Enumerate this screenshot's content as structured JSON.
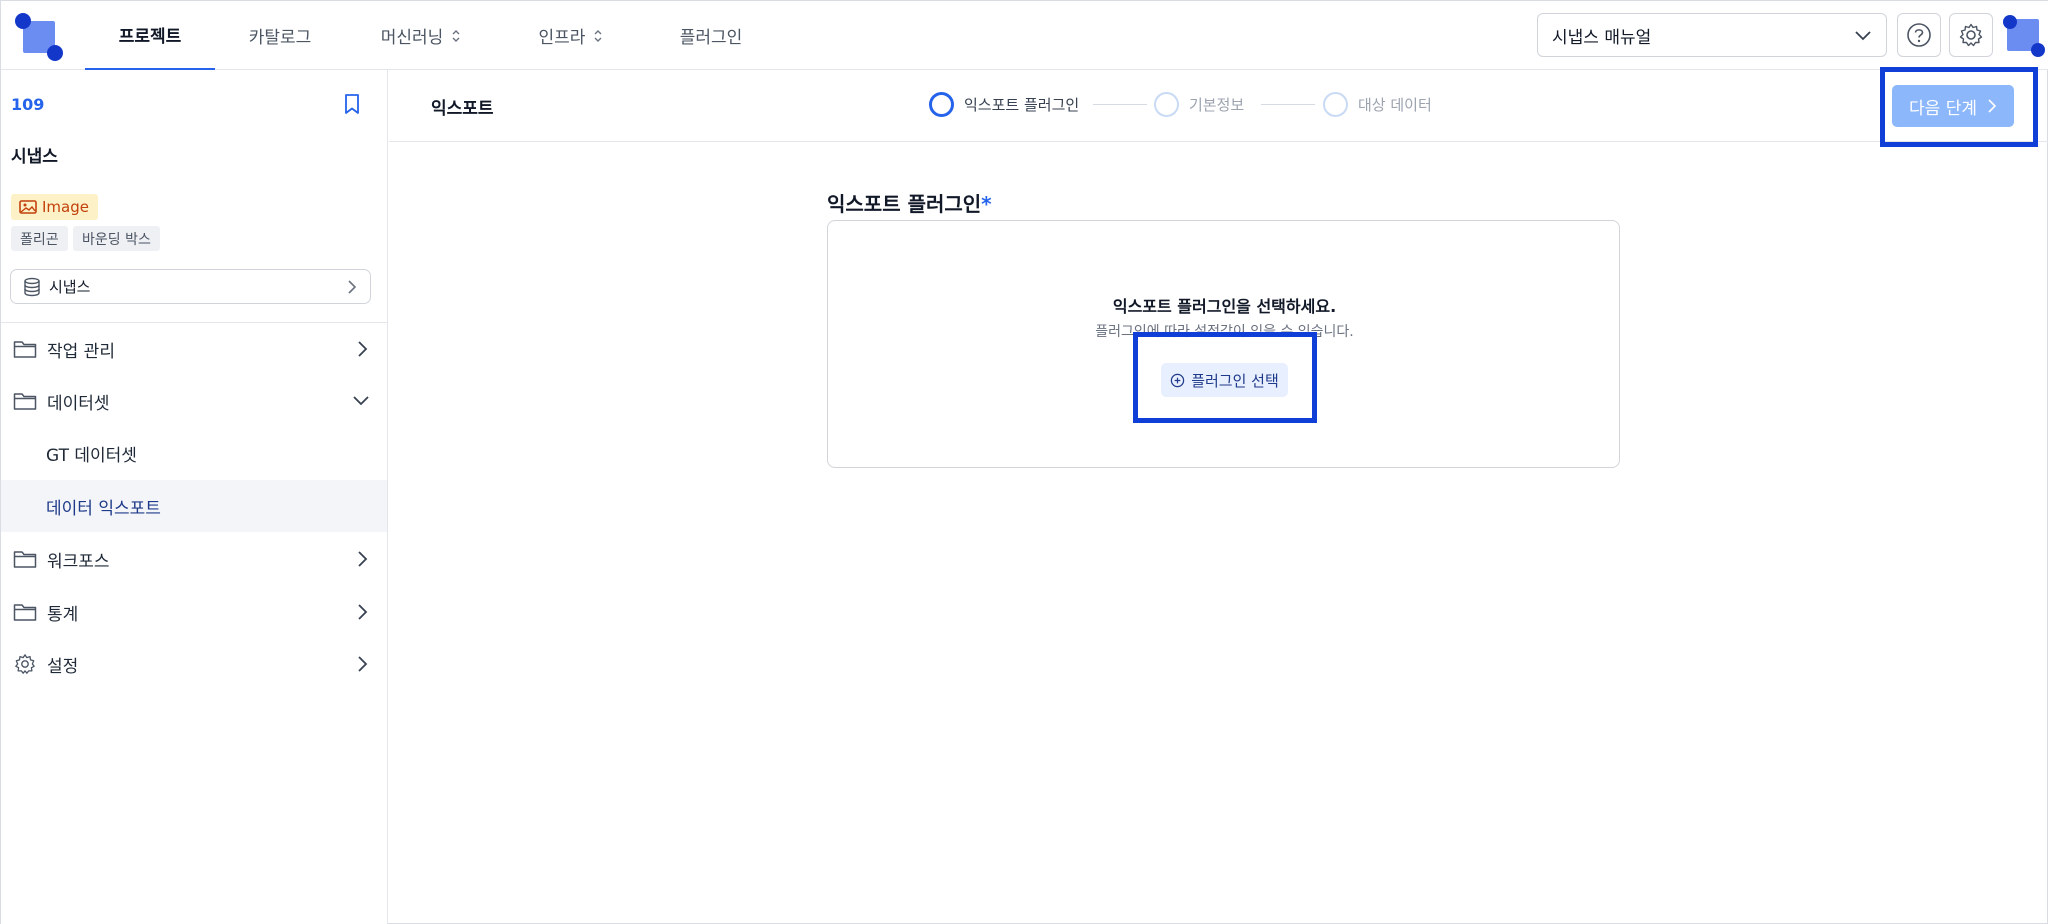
{
  "nav": {
    "items": [
      {
        "label": "프로젝트",
        "active": true
      },
      {
        "label": "카탈로그"
      },
      {
        "label": "머신러닝",
        "dropdown": true
      },
      {
        "label": "인프라",
        "dropdown": true
      },
      {
        "label": "플러그인"
      }
    ],
    "manual_select": "시냅스 매뉴얼"
  },
  "sidebar": {
    "project_id": "109",
    "project_name": "시냅스",
    "data_type_badge": "Image",
    "tags": [
      "폴리곤",
      "바운딩 박스"
    ],
    "dataset_selector": "시냅스",
    "menu": [
      {
        "label": "작업 관리"
      },
      {
        "label": "데이터셋",
        "expanded": true,
        "children": [
          {
            "label": "GT 데이터셋"
          },
          {
            "label": "데이터 익스포트",
            "active": true
          }
        ]
      },
      {
        "label": "워크포스"
      },
      {
        "label": "통계"
      },
      {
        "label": "설정"
      }
    ]
  },
  "main": {
    "page_title": "익스포트",
    "steps": [
      {
        "label": "익스포트 플러그인",
        "active": true
      },
      {
        "label": "기본정보"
      },
      {
        "label": "대상 데이터"
      }
    ],
    "next_button": "다음 단계",
    "section_title": "익스포트 플러그인",
    "required_mark": "*",
    "empty_message": "익스포트 플러그인을 선택하세요.",
    "empty_sub": "플러그인에 따라 설정값이 있을 수 있습니다.",
    "select_plugin_button": "플러그인 선택"
  },
  "colors": {
    "accent": "#2563eb",
    "highlight": "#0f3fd6",
    "next_button_bg": "#8cb7fa"
  }
}
